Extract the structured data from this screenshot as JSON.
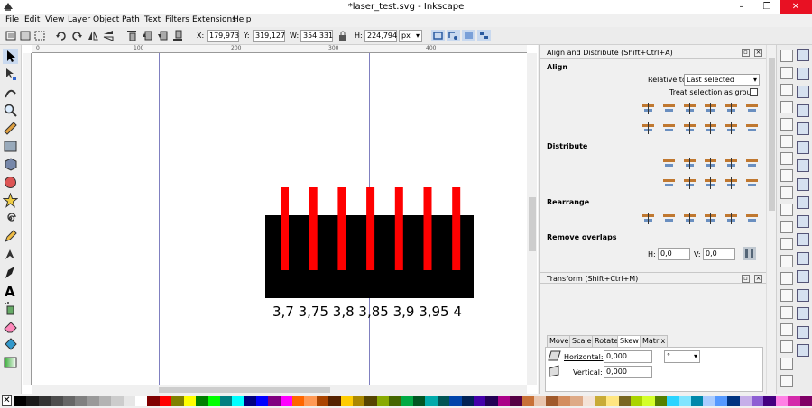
{
  "window": {
    "title": "*laser_test.svg - Inkscape",
    "minimize": "–",
    "restore": "❐",
    "close": "✕"
  },
  "menu": [
    "File",
    "Edit",
    "View",
    "Layer",
    "Object",
    "Path",
    "Text",
    "Filters",
    "Extensions",
    "Help"
  ],
  "toolbar": {
    "x_label": "X:",
    "x_value": "179,973",
    "y_label": "Y:",
    "y_value": "319,127",
    "w_label": "W:",
    "w_value": "354,331",
    "h_label": "H:",
    "h_value": "224,794",
    "unit": "px"
  },
  "canvas": {
    "ruler_ticks": [
      "0",
      "100",
      "200",
      "300",
      "400"
    ],
    "label_text": "3,7 3,75 3,8 3,85 3,9 3,95 4",
    "bar_count": 7,
    "colors": {
      "base": "#000000",
      "bars": "#ff0000",
      "guide": "#8080c0"
    }
  },
  "align_panel": {
    "title": "Align and Distribute (Shift+Ctrl+A)",
    "align_heading": "Align",
    "relative_label": "Relative to:",
    "relative_value": "Last selected",
    "treat_label": "Treat selection as group:",
    "distribute_heading": "Distribute",
    "rearrange_heading": "Rearrange",
    "remove_overlaps_heading": "Remove overlaps",
    "h_label": "H:",
    "h_value": "0,0",
    "v_label": "V:",
    "v_value": "0,0"
  },
  "transform_panel": {
    "title": "Transform (Shift+Ctrl+M)",
    "tabs": [
      "Move",
      "Scale",
      "Rotate",
      "Skew",
      "Matrix"
    ],
    "active_tab": "Skew",
    "horizontal_label": "Horizontal:",
    "horizontal_value": "0,000",
    "horizontal_unit": "°",
    "vertical_label": "Vertical:",
    "vertical_value": "0,000"
  },
  "palette_colors": [
    "#000000",
    "#1a1a1a",
    "#333333",
    "#4d4d4d",
    "#666666",
    "#808080",
    "#999999",
    "#b3b3b3",
    "#cccccc",
    "#e6e6e6",
    "#ffffff",
    "#800000",
    "#ff0000",
    "#808000",
    "#ffff00",
    "#008000",
    "#00ff00",
    "#008080",
    "#00ffff",
    "#000080",
    "#0000ff",
    "#800080",
    "#ff00ff",
    "#ff6600",
    "#ff9955",
    "#aa4400",
    "#552200",
    "#ffcc00",
    "#aa8800",
    "#554400",
    "#88aa00",
    "#446600",
    "#00aa44",
    "#005522",
    "#00aaaa",
    "#005555",
    "#0044aa",
    "#002255",
    "#4400aa",
    "#220055",
    "#aa0088",
    "#550044",
    "#c87137",
    "#e9c6af",
    "#a05a2c",
    "#d38d5f",
    "#deaa87",
    "#f4e3d7",
    "#c8ab37",
    "#ffe680",
    "#786721",
    "#aad400",
    "#d4ff2a",
    "#558000",
    "#2ad4ff",
    "#80e5ff",
    "#0088aa",
    "#aaccff",
    "#5599ff",
    "#003380",
    "#c6afe9",
    "#8d5fd3",
    "#440080",
    "#ff80e5",
    "#d42aaa",
    "#800066"
  ]
}
